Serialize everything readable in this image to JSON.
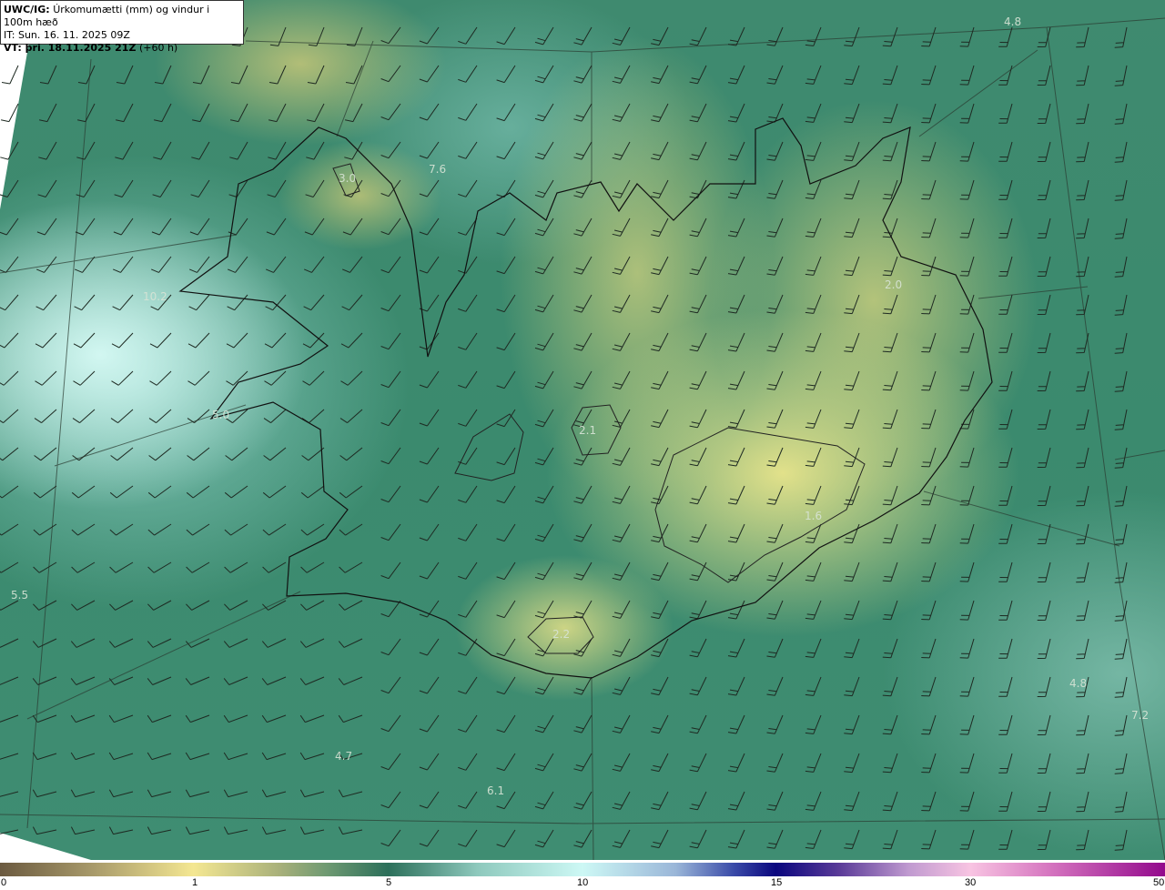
{
  "title": {
    "model": "UWC/IG:",
    "description": "Úrkomumætti (mm) og vindur i 100m hæð",
    "initial_time": "IT: Sun. 16. 11. 2025 09Z",
    "valid_label": "VT: þri. 18.11.2025 21Z",
    "lead_time": "(+60 h)"
  },
  "map_values": [
    "4.8",
    "3.0",
    "7.6",
    "10.2",
    "2.0",
    "5.0",
    "2.1",
    "1.6",
    "2.2",
    "5.5",
    "4.7",
    "6.1",
    "4.8",
    "7.2"
  ],
  "colorbar": {
    "unit": "mm",
    "ticks": [
      "0",
      "1",
      "5",
      "10",
      "15",
      "30",
      "50"
    ]
  }
}
